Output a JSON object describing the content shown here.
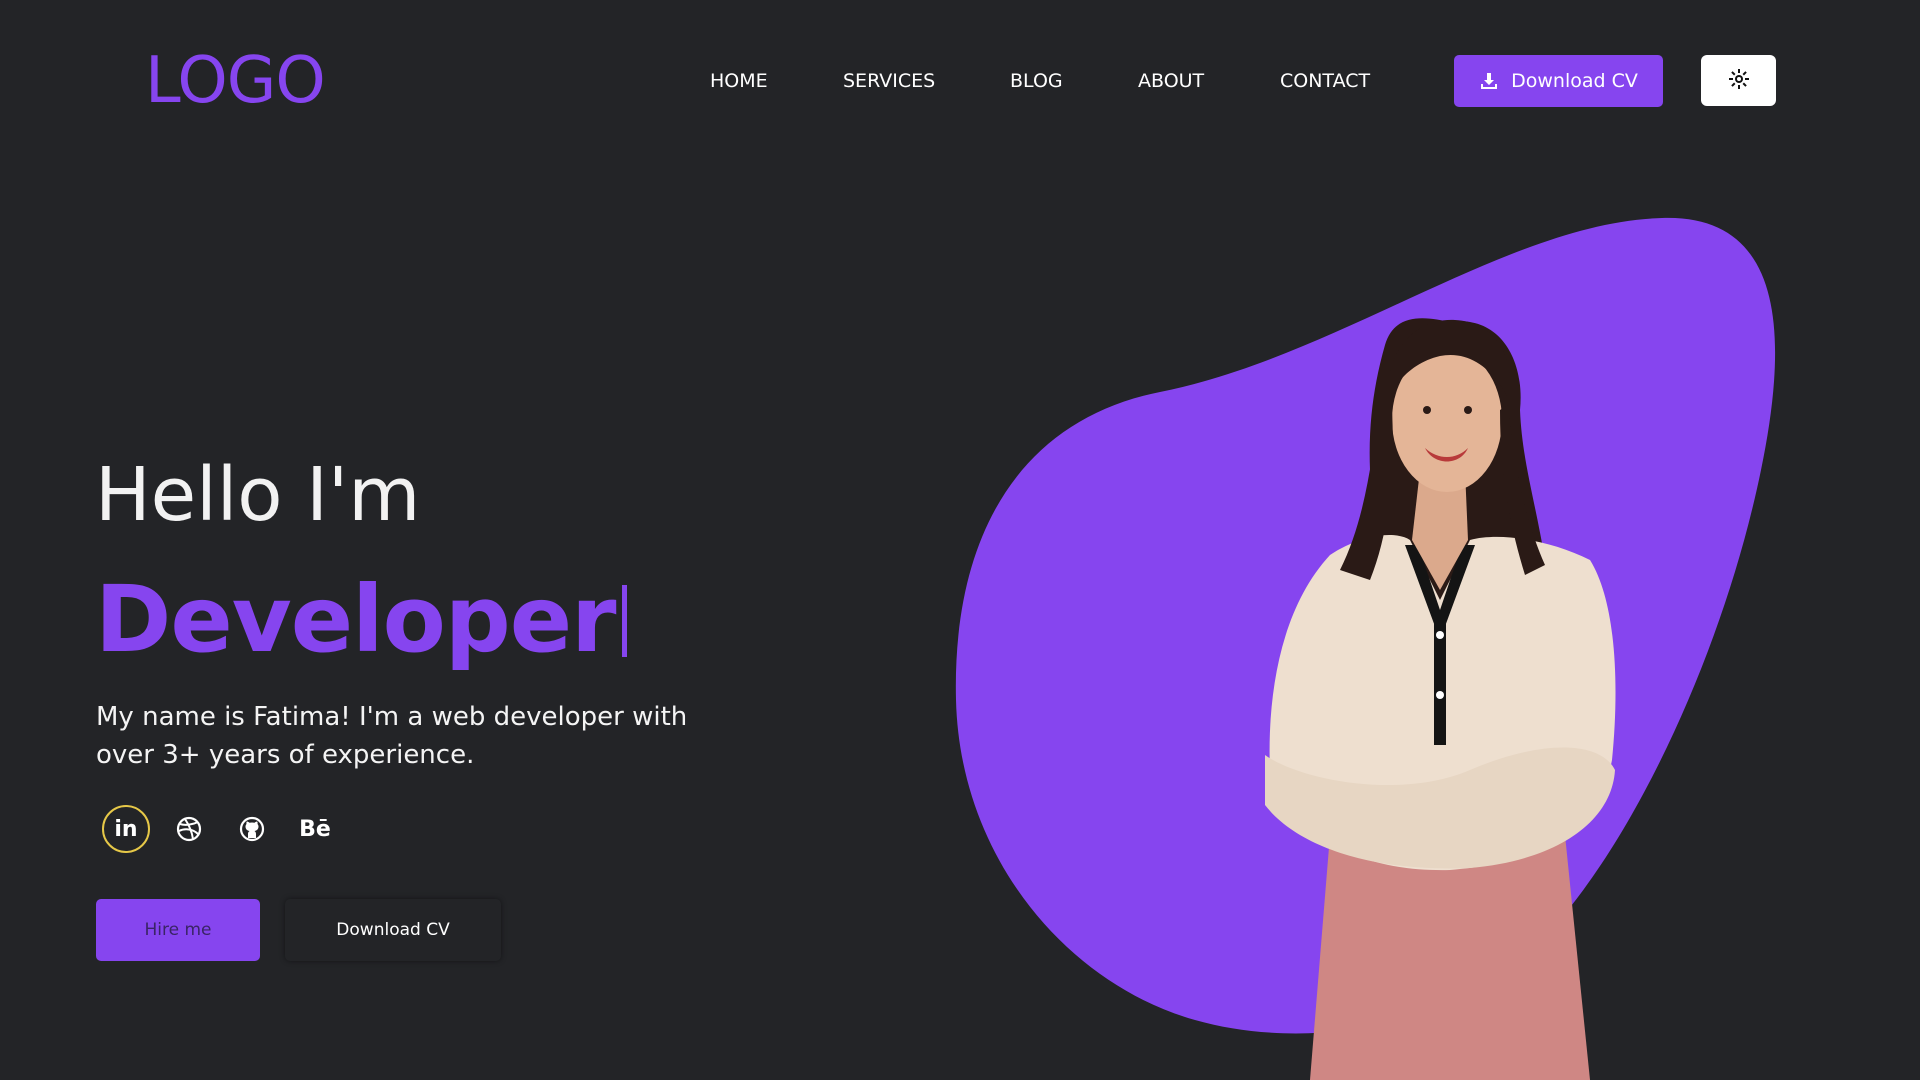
{
  "header": {
    "logo": "LOGO",
    "nav": [
      "HOME",
      "SERVICES",
      "BLOG",
      "ABOUT",
      "CONTACT"
    ],
    "download_cv_label": "Download CV",
    "download_icon": "download-icon",
    "theme_icon": "sun-icon"
  },
  "hero": {
    "greeting": "Hello I'm",
    "role": "Developer",
    "intro_line1": "My name is Fatima! I'm a web developer with",
    "intro_line2": "over 3+ years of experience.",
    "socials": {
      "linkedin": "in",
      "dribbble_icon": "dribbble-icon",
      "github_icon": "github-icon",
      "behance": "Bē"
    },
    "hire_label": "Hire me",
    "download_cv_label": "Download CV"
  },
  "colors": {
    "background": "#232427",
    "accent": "#8645ef",
    "highlight_ring": "#e6c848",
    "text": "#ffffff"
  }
}
